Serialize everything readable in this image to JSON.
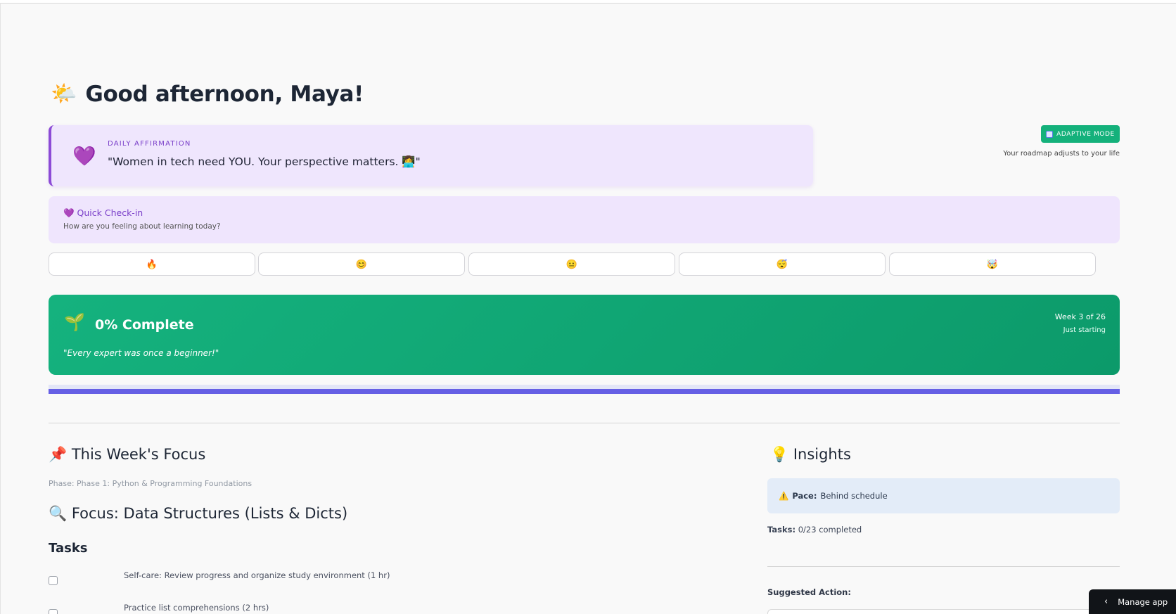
{
  "greeting": {
    "emoji": "🌤️",
    "text": "Good afternoon, Maya!"
  },
  "affirmation": {
    "icon": "💜",
    "label": "DAILY AFFIRMATION",
    "quote": "\"Women in tech need YOU. Your perspective matters. 👩‍💻\""
  },
  "adaptive": {
    "badge": "ADAPTIVE MODE",
    "subtitle": "Your roadmap adjusts to your life"
  },
  "checkin": {
    "title": "💜 Quick Check-in",
    "subtitle": "How are you feeling about learning today?",
    "moods": [
      "🔥",
      "😊",
      "😐",
      "😴",
      "🤯"
    ]
  },
  "progress": {
    "icon": "🌱",
    "percent_label": "0% Complete",
    "motto": "\"Every expert was once a beginner!\"",
    "week": "Week 3 of 26",
    "stage": "Just starting",
    "bar_fraction": 1.0,
    "bar_color": "#6660e5",
    "card_color": "#12a874"
  },
  "week_focus": {
    "heading": "📌 This Week's Focus",
    "phase": "Phase: Phase 1: Python & Programming Foundations",
    "focus_heading": "🔍 Focus: Data Structures (Lists & Dicts)",
    "tasks_heading": "Tasks",
    "tasks": [
      "Self-care: Review progress and organize study environment (1 hr)",
      "Practice list comprehensions (2 hrs)"
    ]
  },
  "insights": {
    "heading": "💡 Insights",
    "pace_icon": "⚠️",
    "pace_label": "Pace:",
    "pace_value": "Behind schedule",
    "tasks_label": "Tasks:",
    "tasks_value": "0/23 completed",
    "suggested_label": "Suggested Action:"
  },
  "manage_app": {
    "label": "Manage app",
    "icon": "chevron-left-icon"
  }
}
